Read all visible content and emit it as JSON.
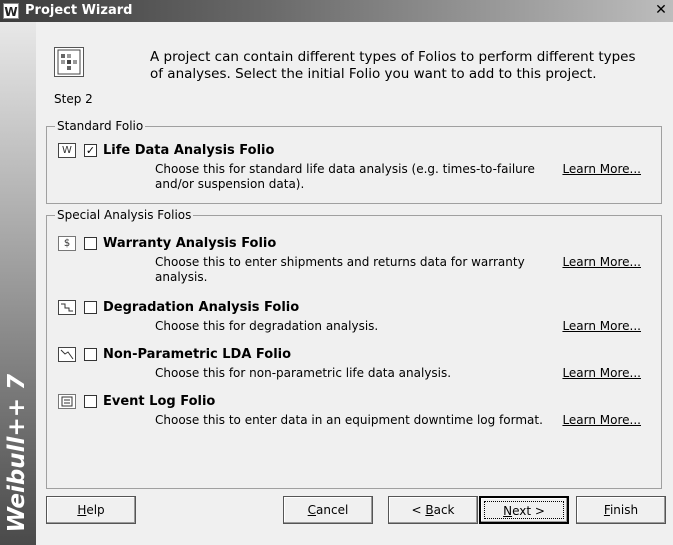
{
  "window": {
    "title": "Project Wizard",
    "app_icon_glyph": "W",
    "close_glyph": "✕",
    "brand_text": "Weibull++ 7"
  },
  "header": {
    "step_label": "Step 2",
    "instruction": "A project can contain different types of Folios to perform different types of analyses. Select the initial Folio you want to add to this project."
  },
  "standard": {
    "legend": "Standard Folio",
    "items": [
      {
        "icon": "life-data-icon",
        "checked": true,
        "name": "Life Data Analysis Folio",
        "description": "Choose this for standard life data analysis (e.g.  times-to-failure and/or suspension data).",
        "learn_more": "Learn More..."
      }
    ]
  },
  "special": {
    "legend": "Special Analysis Folios",
    "items": [
      {
        "icon": "warranty-icon",
        "checked": false,
        "name": "Warranty Analysis Folio",
        "description": "Choose this to enter shipments and returns data for warranty analysis.",
        "learn_more": "Learn More..."
      },
      {
        "icon": "degradation-icon",
        "checked": false,
        "name": "Degradation Analysis Folio",
        "description": "Choose this for degradation analysis.",
        "learn_more": "Learn More..."
      },
      {
        "icon": "non-parametric-icon",
        "checked": false,
        "name": "Non-Parametric LDA Folio",
        "description": "Choose this for non-parametric life data analysis.",
        "learn_more": "Learn More..."
      },
      {
        "icon": "event-log-icon",
        "checked": false,
        "name": "Event Log Folio",
        "description": "Choose this to enter data in an equipment downtime log format.",
        "learn_more": "Learn More..."
      }
    ]
  },
  "buttons": {
    "help": {
      "pre": "",
      "key": "H",
      "post": "elp"
    },
    "cancel": {
      "pre": "",
      "key": "C",
      "post": "ancel"
    },
    "back": {
      "pre": "< ",
      "key": "B",
      "post": "ack"
    },
    "next": {
      "pre": "",
      "key": "N",
      "post": "ext >"
    },
    "finish": {
      "pre": "",
      "key": "F",
      "post": "inish"
    }
  }
}
